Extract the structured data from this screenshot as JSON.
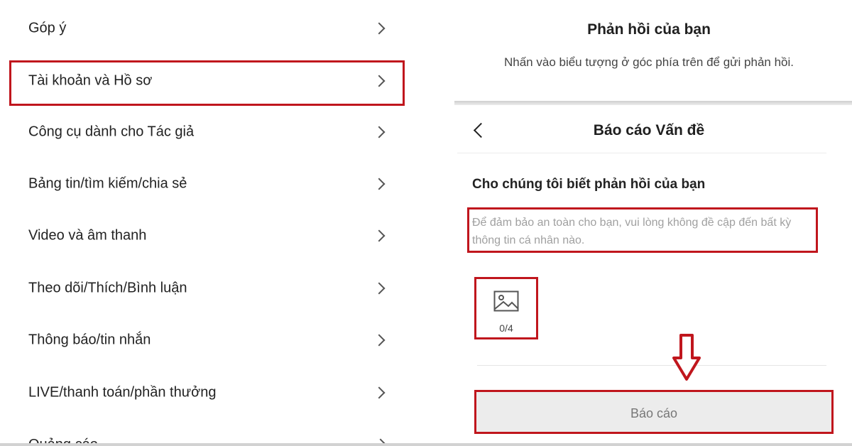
{
  "menu": {
    "items": [
      {
        "label": "Góp ý"
      },
      {
        "label": "Tài khoản và Hồ sơ",
        "highlighted": true
      },
      {
        "label": "Công cụ dành cho Tác giả"
      },
      {
        "label": "Bảng tin/tìm kiếm/chia sẻ"
      },
      {
        "label": "Video và âm thanh"
      },
      {
        "label": "Theo dõi/Thích/Bình luận"
      },
      {
        "label": "Thông báo/tin nhắn"
      },
      {
        "label": "LIVE/thanh toán/phần thưởng"
      }
    ],
    "cut_off_label": "Quảng cáo"
  },
  "feedback": {
    "title": "Phản hồi của bạn",
    "subtitle": "Nhấn vào biểu tượng ở góc phía trên để gửi phản hồi."
  },
  "report": {
    "title": "Báo cáo Vấn đề",
    "section_label": "Cho chúng tôi biết phản hồi của bạn",
    "textarea_placeholder": "Để đảm bảo an toàn cho bạn, vui lòng không đề cập đến bất kỳ thông tin cá nhân nào.",
    "upload_count": "0/4",
    "submit_label": "Báo cáo"
  },
  "colors": {
    "annotation_red": "#c0161d",
    "button_bg": "#ececec"
  },
  "icons": [
    "chevron-right-icon",
    "back-chevron-icon",
    "image-icon",
    "down-arrow-annotation-icon"
  ]
}
